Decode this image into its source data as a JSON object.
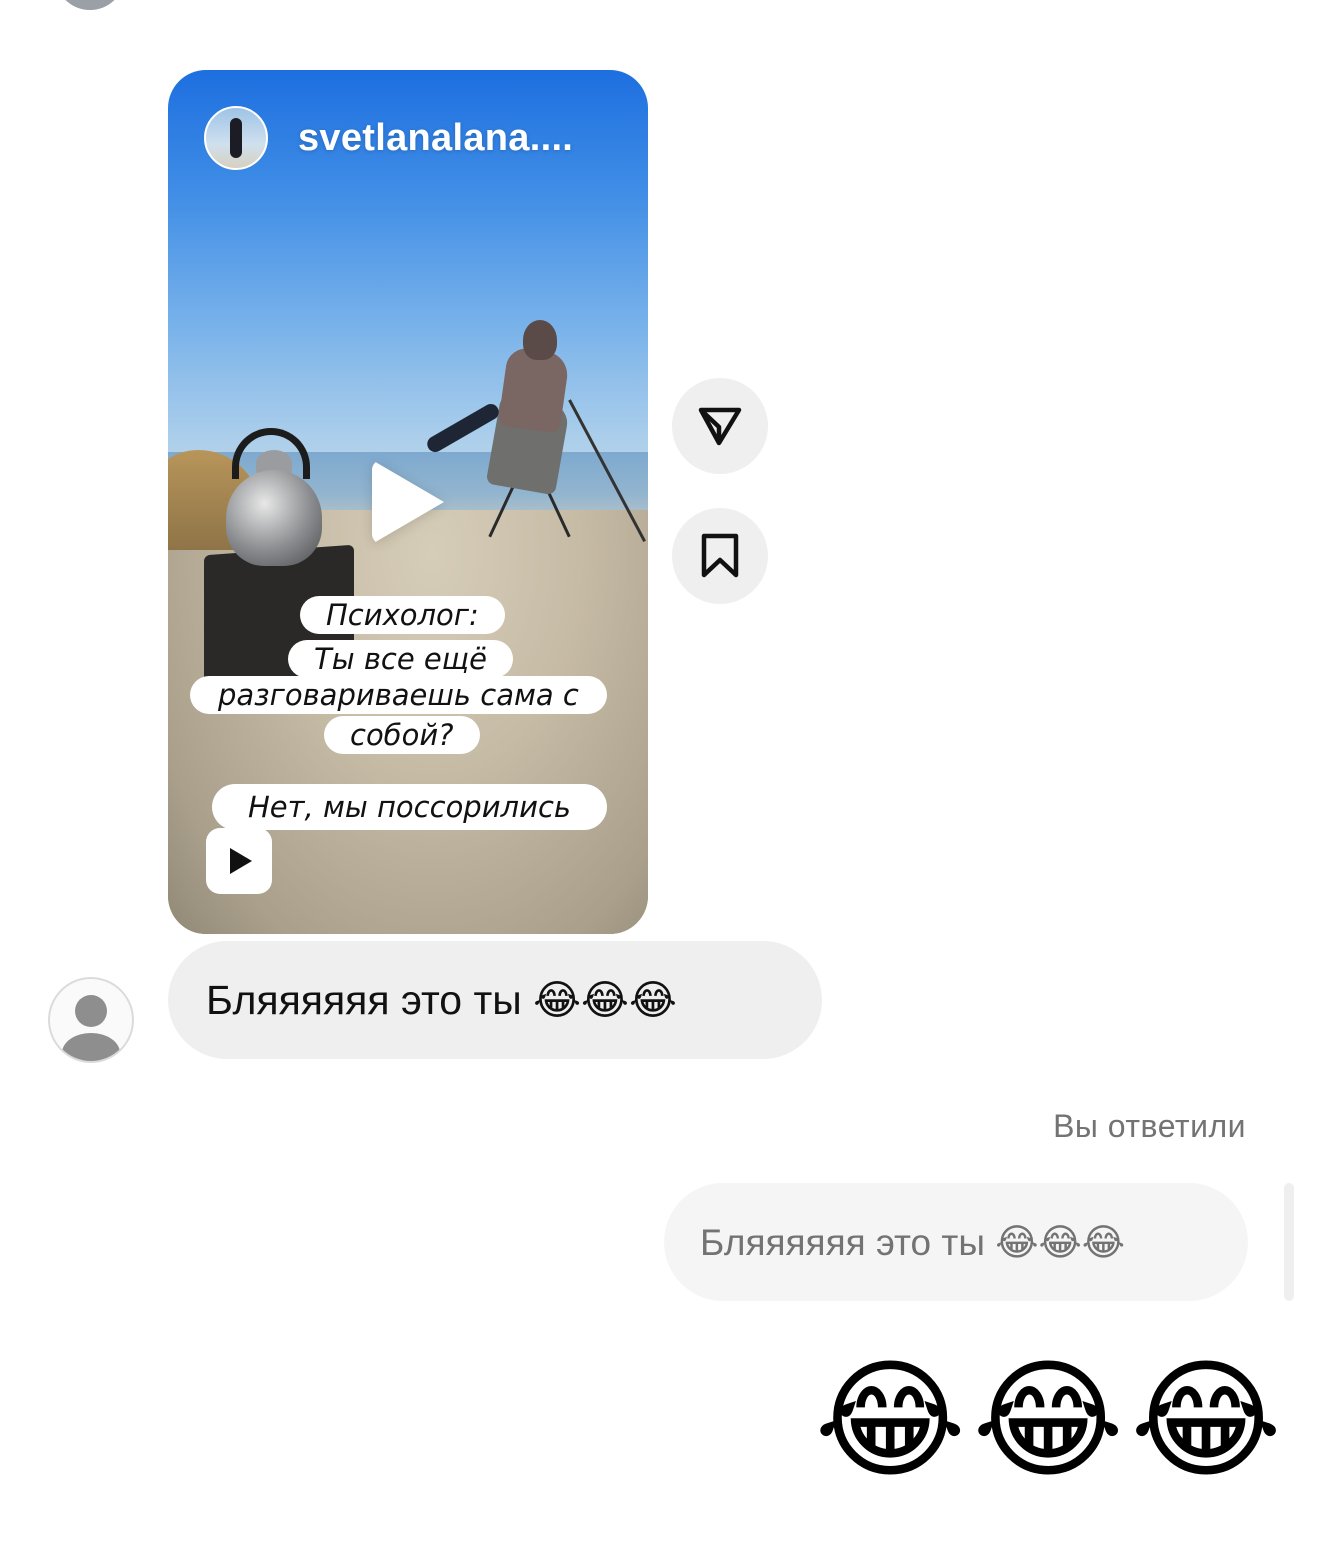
{
  "shared_reel": {
    "username": "svetlanalana....",
    "caption_question_lines": [
      "Психолог:",
      "Ты все ещё",
      "разговариваешь сама с",
      "собой?"
    ],
    "caption_answer": "Нет, мы поссорились"
  },
  "actions": {
    "share_icon": "send-icon",
    "save_icon": "bookmark-icon"
  },
  "incoming_message": {
    "text": "Бляяяяяя это ты 😂😂😂"
  },
  "reply": {
    "label": "Вы ответили",
    "quoted_text": "Бляяяяяя это ты 😂😂😂",
    "emoji_message": "😂😂😂"
  },
  "colors": {
    "bubble_gray": "#efefef",
    "secondary_text": "#737373"
  }
}
